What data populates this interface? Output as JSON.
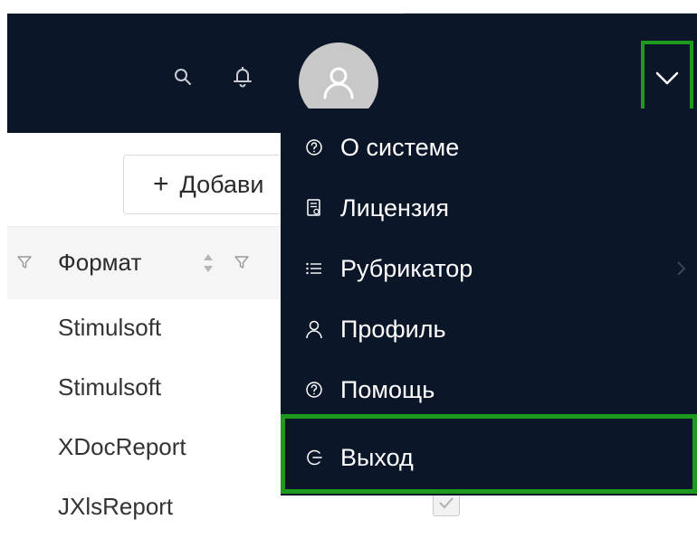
{
  "header": {
    "icons": {
      "search": "search-icon",
      "notifications": "bell-icon",
      "user": "user-icon",
      "expand": "chevron-down-icon"
    },
    "colors": {
      "header_bg": "#0b1628",
      "highlight": "#1d9a1d",
      "avatar_bg": "#c8c8c8"
    }
  },
  "toolbar": {
    "add_label": "Добави"
  },
  "table": {
    "column_header": "Формат",
    "rows": [
      {
        "format": "Stimulsoft"
      },
      {
        "format": "Stimulsoft"
      },
      {
        "format": "XDocReport"
      },
      {
        "format": "JXlsReport"
      }
    ]
  },
  "user_menu": {
    "items": [
      {
        "label": "О системе",
        "icon": "question-circle-icon"
      },
      {
        "label": "Лицензия",
        "icon": "license-doc-icon"
      },
      {
        "label": "Рубрикатор",
        "icon": "list-icon",
        "has_submenu": true
      },
      {
        "label": "Профиль",
        "icon": "user-icon"
      },
      {
        "label": "Помощь",
        "icon": "question-circle-icon"
      }
    ],
    "logout": {
      "label": "Выход",
      "icon": "logout-icon"
    }
  }
}
